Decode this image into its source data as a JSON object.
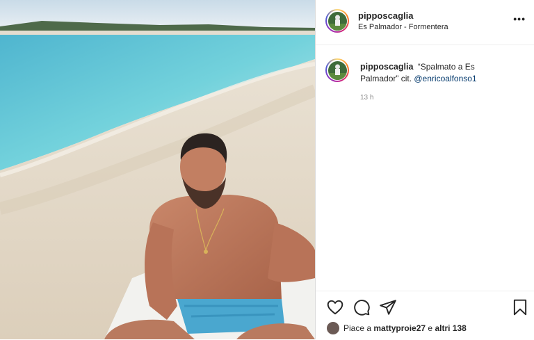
{
  "post": {
    "username": "pipposcaglia",
    "location": "Es Palmador - Formentera",
    "more_label": "•••",
    "caption": {
      "username": "pipposcaglia",
      "text": "“Spalmato a Es Palmador” cit.",
      "mention": "@enricoalfonso1",
      "time": "13 h"
    },
    "likes": {
      "prefix": "Piace a",
      "user": "mattyproie27",
      "suffix": "e",
      "others": "altri 138"
    }
  },
  "icons": [
    "heart-icon",
    "comment-icon",
    "share-icon",
    "bookmark-icon",
    "more-icon"
  ],
  "colors": {
    "border": "#dbdbdb",
    "text": "#262626",
    "muted": "#8e8e8e",
    "link": "#00376b",
    "sea": "#5fc9d6"
  }
}
